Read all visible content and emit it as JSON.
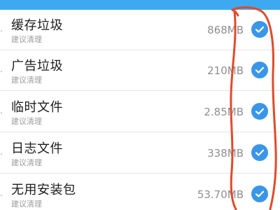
{
  "colors": {
    "header": "#3da9f0",
    "check": "#3a96e8",
    "annotation": "#e04a2b"
  },
  "items": [
    {
      "title": "缓存垃圾",
      "subtitle": "建议清理",
      "size": "868MB",
      "checked": true,
      "icon": "check-circle-icon"
    },
    {
      "title": "广告垃圾",
      "subtitle": "建议清理",
      "size": "210MB",
      "checked": true,
      "icon": "check-circle-icon"
    },
    {
      "title": "临时文件",
      "subtitle": "建议清理",
      "size": "2.85MB",
      "checked": true,
      "icon": "check-circle-icon"
    },
    {
      "title": "日志文件",
      "subtitle": "建议清理",
      "size": "338MB",
      "checked": true,
      "icon": "check-circle-icon"
    },
    {
      "title": "无用安装包",
      "subtitle": "建议清理",
      "size": "53.70MB",
      "checked": true,
      "icon": "check-circle-icon"
    }
  ]
}
